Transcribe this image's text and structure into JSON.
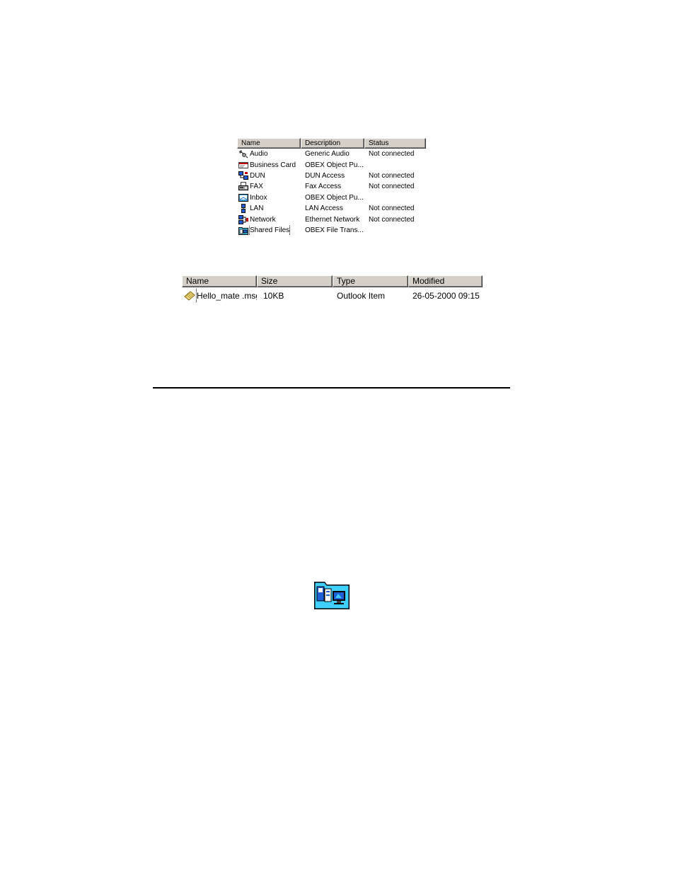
{
  "services_list": {
    "columns": [
      "Name",
      "Description",
      "Status"
    ],
    "rows": [
      {
        "icon": "audio-icon",
        "name": "Audio",
        "description": "Generic Audio",
        "status": "Not connected"
      },
      {
        "icon": "business-card-icon",
        "name": "Business Card",
        "description": "OBEX Object Pu...",
        "status": ""
      },
      {
        "icon": "dun-icon",
        "name": "DUN",
        "description": "DUN Access",
        "status": "Not connected"
      },
      {
        "icon": "fax-icon",
        "name": "FAX",
        "description": "Fax Access",
        "status": "Not connected"
      },
      {
        "icon": "inbox-icon",
        "name": "Inbox",
        "description": "OBEX Object Pu...",
        "status": ""
      },
      {
        "icon": "lan-icon",
        "name": "LAN",
        "description": "LAN Access",
        "status": "Not connected"
      },
      {
        "icon": "network-icon",
        "name": "Network",
        "description": "Ethernet Network",
        "status": "Not connected"
      },
      {
        "icon": "shared-files-icon",
        "name": "Shared Files",
        "description": "OBEX File Trans...",
        "status": "",
        "focused": true
      }
    ]
  },
  "files_list": {
    "columns": [
      "Name",
      "Size",
      "Type",
      "Modified"
    ],
    "rows": [
      {
        "icon": "outlook-message-icon",
        "name": "Hello_mate .msg",
        "size": "10KB",
        "type": "Outlook Item",
        "modified": "26-05-2000 09:15",
        "focused": true
      }
    ]
  },
  "icons": {
    "shared_folder": "shared-folder-icon"
  },
  "colors": {
    "header_bg": "#d4d0c8",
    "icon_blue": "#1f5fd6",
    "icon_cyan": "#3fd0ff"
  }
}
